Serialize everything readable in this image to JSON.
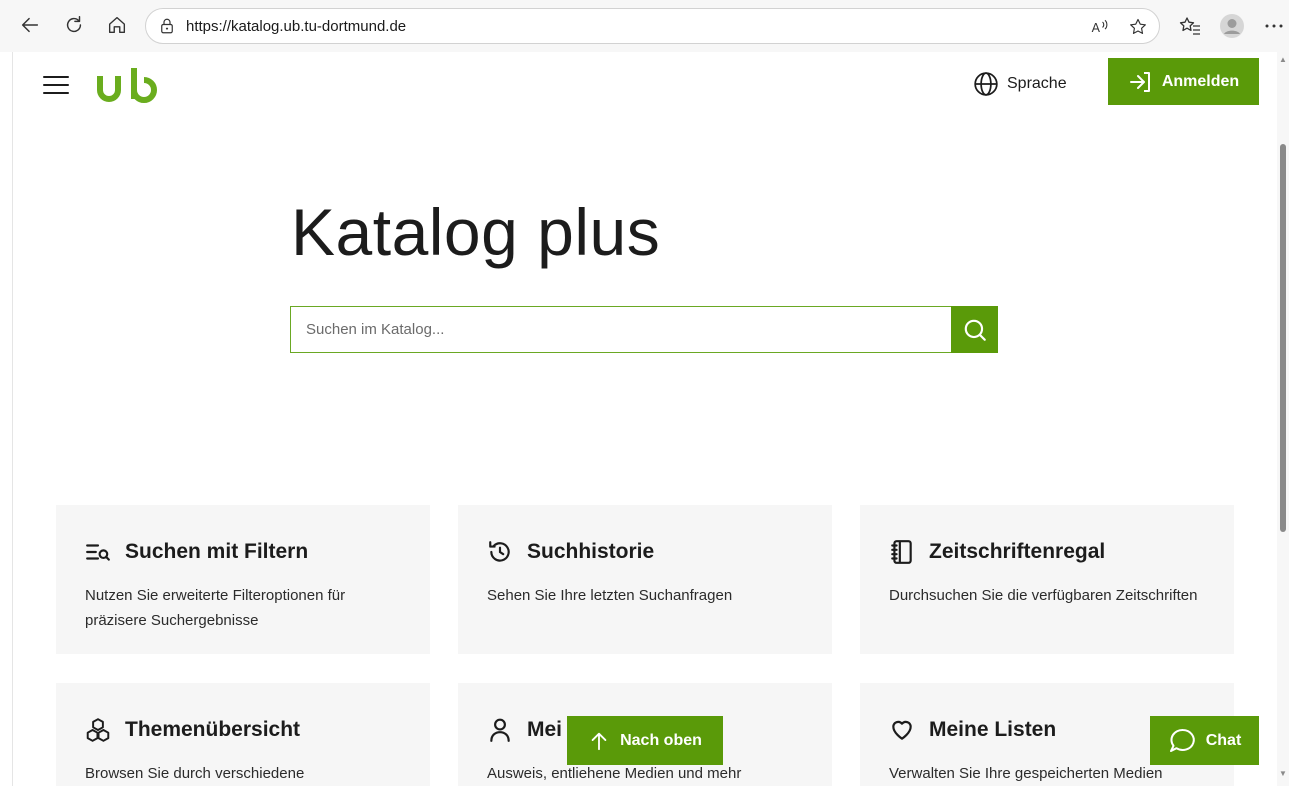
{
  "browser": {
    "url": "https://katalog.ub.tu-dortmund.de"
  },
  "header": {
    "logo_text": "ub",
    "language_label": "Sprache",
    "login_label": "Anmelden"
  },
  "hero": {
    "title": "Katalog plus",
    "search_placeholder": "Suchen im Katalog..."
  },
  "cards": [
    {
      "icon": "filter-search-icon",
      "title": "Suchen mit Filtern",
      "desc": "Nutzen Sie erweiterte Filteroptionen für präzisere Suchergebnisse"
    },
    {
      "icon": "history-icon",
      "title": "Suchhistorie",
      "desc": "Sehen Sie Ihre letzten Suchanfragen"
    },
    {
      "icon": "journal-icon",
      "title": "Zeitschriftenregal",
      "desc": "Durchsuchen Sie die verfügbaren Zeitschriften"
    },
    {
      "icon": "topics-icon",
      "title": "Themenübersicht",
      "desc": "Browsen Sie durch verschiedene"
    },
    {
      "icon": "user-icon",
      "title": "Mei",
      "desc": "Ausweis, entliehene Medien und mehr"
    },
    {
      "icon": "heart-icon",
      "title": "Meine Listen",
      "desc": "Verwalten Sie Ihre gespeicherten Medien"
    }
  ],
  "floating": {
    "back_to_top_label": "Nach oben",
    "chat_label": "Chat"
  },
  "colors": {
    "accent": "#5a9a09",
    "card_bg": "#f6f6f6"
  }
}
